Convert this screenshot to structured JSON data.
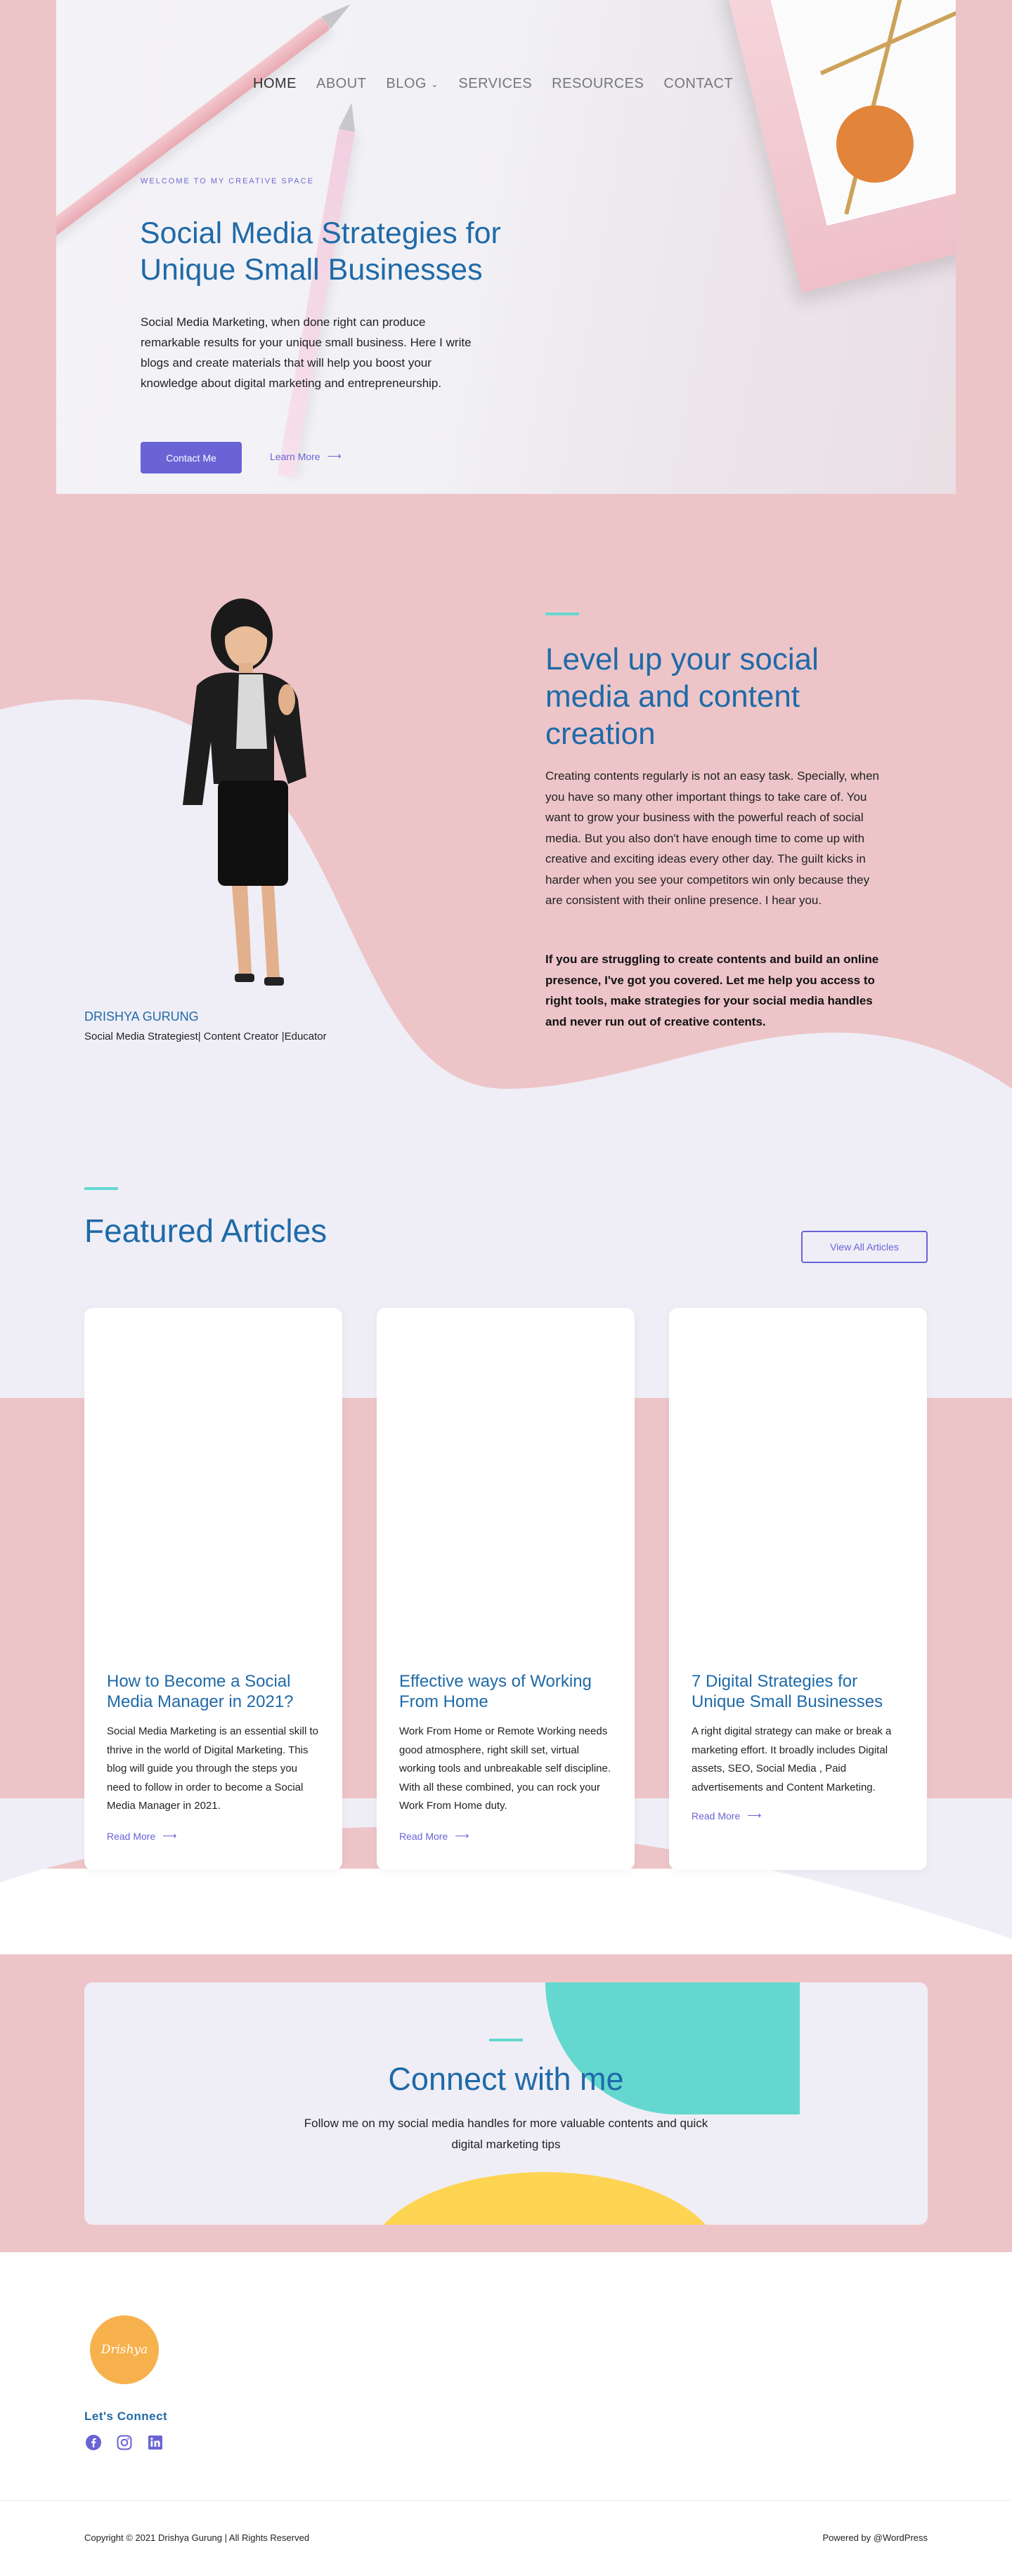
{
  "nav": {
    "items": [
      {
        "label": "HOME",
        "active": true
      },
      {
        "label": "ABOUT"
      },
      {
        "label": "BLOG",
        "dropdown": true
      },
      {
        "label": "SERVICES"
      },
      {
        "label": "RESOURCES"
      },
      {
        "label": "CONTACT"
      }
    ]
  },
  "hero": {
    "eyebrow": "WELCOME TO MY CREATIVE SPACE",
    "title": "Social Media Strategies for Unique Small Businesses",
    "text": "Social Media Marketing, when done right can produce remarkable results for your unique small business.  Here I write blogs and create materials that will help you boost your  knowledge about digital marketing and entrepreneurship.",
    "cta_label": "Contact Me",
    "learn_label": "Learn More",
    "learn_icon": "arrow-right-icon"
  },
  "about": {
    "name": "DRISHYA GURUNG",
    "role": "Social Media Strategiest| Content Creator |Educator",
    "title": "Level up your social media and content creation",
    "text": "Creating contents regularly is not an easy task. Specially, when you have so many other important things to take care of.  You want to grow your business with the powerful reach of social media. But you also don't have enough time to come up with creative and exciting ideas every other day. The guilt kicks in harder when you see your competitors win only because they are consistent with their online presence. I hear you.",
    "bold_text": "If  you are struggling to create contents and build an online presence, I've got you covered. Let me help you access to right tools,  make strategies for your social media handles and never run out of creative contents."
  },
  "articles": {
    "title": "Featured Articles",
    "view_all": "View All Articles",
    "read_more": "Read More",
    "cards": [
      {
        "title": "How to Become a Social Media Manager in 2021?",
        "excerpt": "Social Media Marketing is an essential skill to thrive in the world of Digital Marketing. This blog will guide you through the steps you need to follow in order to become a Social Media Manager in 2021."
      },
      {
        "title": "Effective ways of Working From Home",
        "excerpt": "Work From Home or Remote Working needs good atmosphere, right skill set, virtual working tools and unbreakable self discipline.  With all these combined, you can rock your Work From Home duty."
      },
      {
        "title": "7 Digital Strategies for Unique Small Businesses",
        "excerpt": "A right digital strategy can make or break a marketing effort. It broadly includes Digital assets, SEO, Social Media , Paid advertisements and Content Marketing."
      }
    ]
  },
  "connect": {
    "title": "Connect with me",
    "text": "Follow me on my social media handles for more valuable contents and quick digital marketing tips"
  },
  "footer": {
    "logo_text": "Drishya",
    "lets_connect": "Let's Connect",
    "socials": [
      "facebook-icon",
      "instagram-icon",
      "linkedin-icon"
    ],
    "copyright": "Copyright © 2021 Drishya Gurung | All Rights Reserved",
    "powered": "Powered by @WordPress"
  },
  "colors": {
    "pink": "#edc5c8",
    "lavender": "#efeef6",
    "blue": "#1f6aa8",
    "purple": "#6963d6",
    "teal": "#64d8cf",
    "yellow": "#fed453",
    "orange": "#f7b24d"
  }
}
